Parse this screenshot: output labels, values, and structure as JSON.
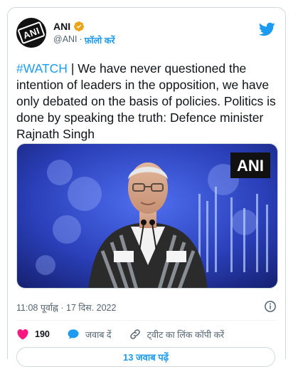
{
  "account": {
    "name": "ANI",
    "handle": "@ANI",
    "separator": "·",
    "follow_label": "फ़ॉलो करें",
    "avatar_text": "ANI"
  },
  "tweet": {
    "hashtag": "#WATCH",
    "text": " | We have never questioned the intention of leaders in the opposition, we have only debated on the basis of policies. Politics is done by speaking the truth: Defence minister Rajnath Singh"
  },
  "media": {
    "watermark": "ANI"
  },
  "meta": {
    "timestamp": "11:08 पूर्वाह्न · 17 दिस. 2022"
  },
  "actions": {
    "like_count": "190",
    "reply_label": "जवाब दें",
    "copy_link_label": "ट्वीट का लिंक कॉपी करें"
  },
  "footer": {
    "read_replies_label": "13 जवाब पढ़ें"
  },
  "colors": {
    "accent": "#1d9bf0",
    "like": "#f91880",
    "muted": "#536471"
  }
}
